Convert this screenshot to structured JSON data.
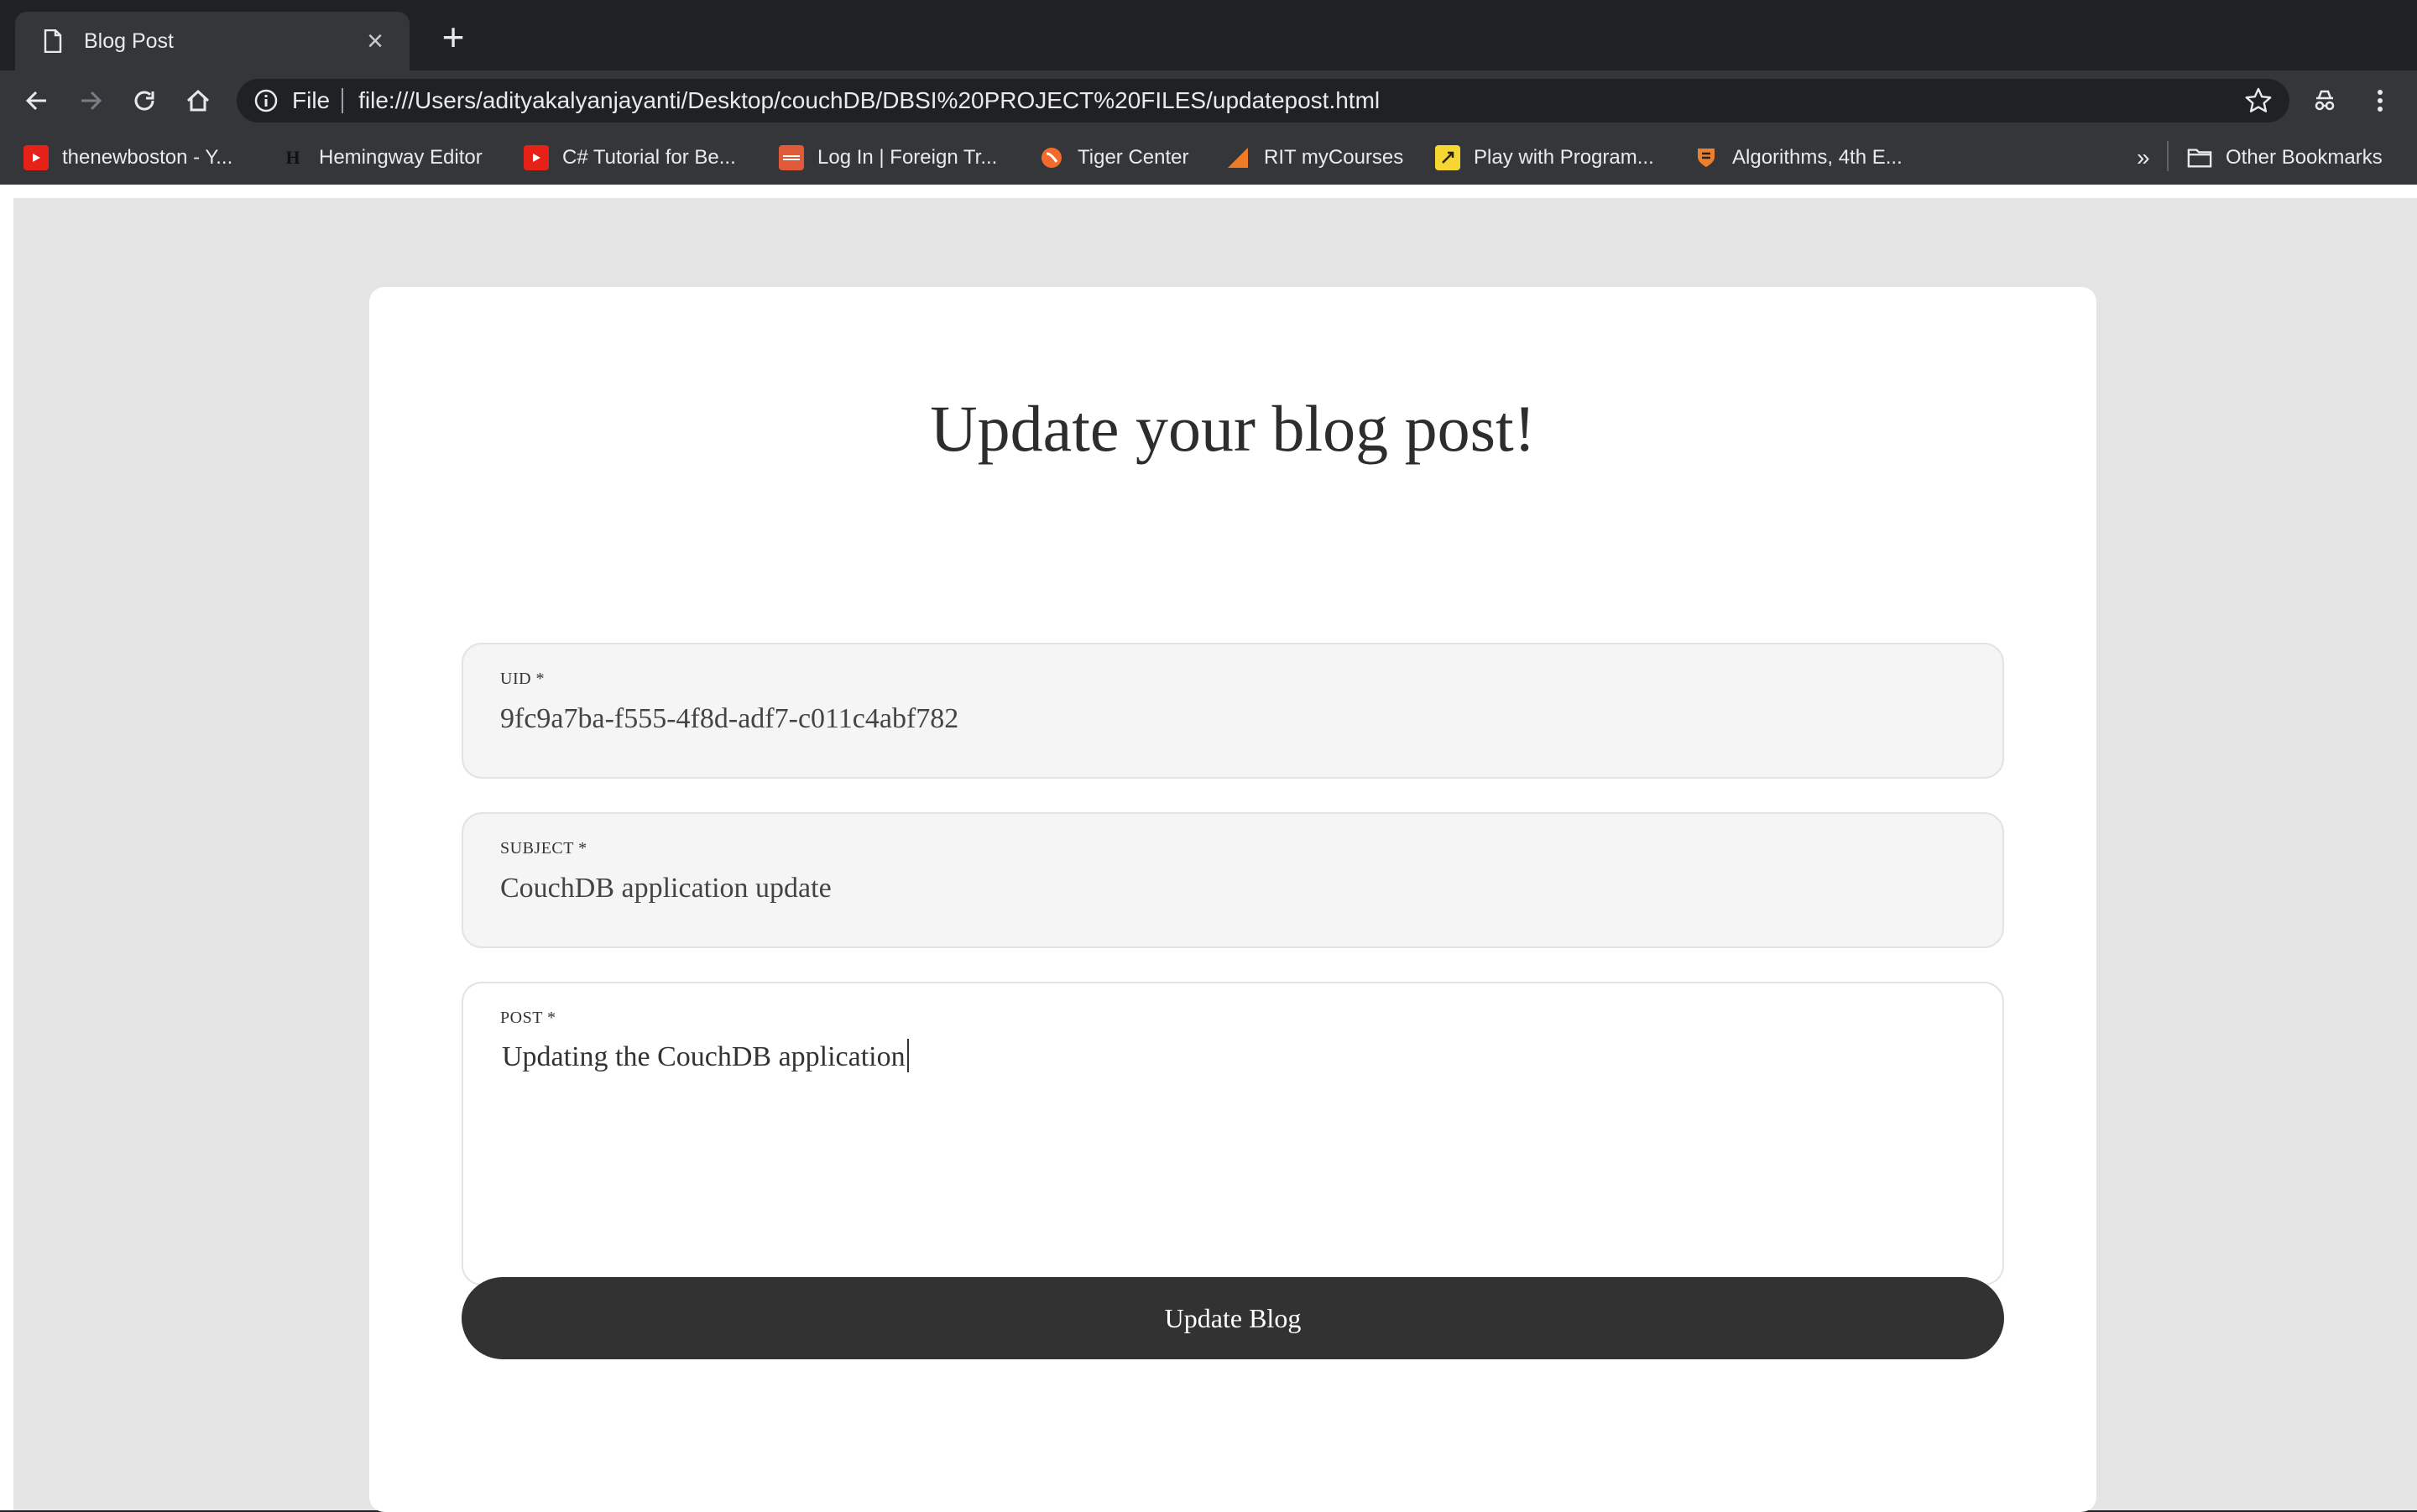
{
  "browser": {
    "tab": {
      "title": "Blog Post"
    },
    "omnibox": {
      "scheme": "File",
      "url": "file:///Users/adityakalyanjayanti/Desktop/couchDB/DBSI%20PROJECT%20FILES/updatepost.html"
    },
    "bookmarks": [
      {
        "label": "thenewboston - Y...",
        "icon": "youtube-icon",
        "color": "#e62117"
      },
      {
        "label": "Hemingway Editor",
        "icon": "hemingway-icon",
        "color": "#222222"
      },
      {
        "label": "C# Tutorial for Be...",
        "icon": "youtube-icon",
        "color": "#e62117"
      },
      {
        "label": "Log In | Foreign Tr...",
        "icon": "foreign-trade-icon",
        "color": "#e05a3a"
      },
      {
        "label": "Tiger Center",
        "icon": "tiger-icon",
        "color": "#f26a2c"
      },
      {
        "label": "RIT myCourses",
        "icon": "rit-icon",
        "color": "#f07b26"
      },
      {
        "label": "Play with Program...",
        "icon": "play-icon",
        "color": "#f5d632"
      },
      {
        "label": "Algorithms, 4th E...",
        "icon": "princeton-icon",
        "color": "#ee7f2d"
      }
    ],
    "overflow_label": "»",
    "other_bookmarks": "Other Bookmarks"
  },
  "page": {
    "heading": "Update your blog post!",
    "fields": {
      "uid": {
        "label": "UID *",
        "value": "9fc9a7ba-f555-4f8d-adf7-c011c4abf782"
      },
      "subject": {
        "label": "SUBJECT *",
        "value": "CouchDB application update"
      },
      "post": {
        "label": "POST *",
        "value": "Updating the CouchDB application"
      }
    },
    "submit_label": "Update Blog"
  }
}
